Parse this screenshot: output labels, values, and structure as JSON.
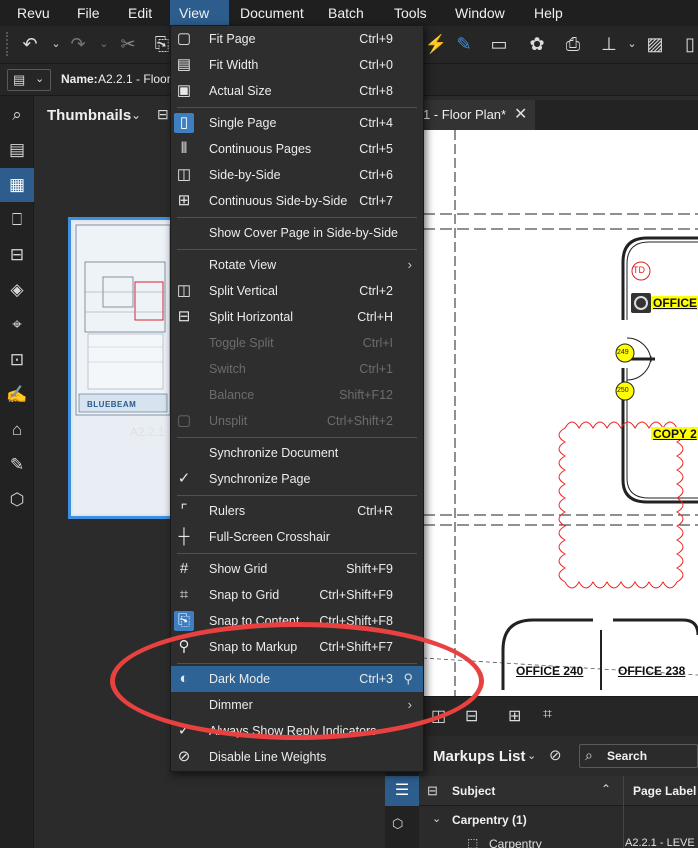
{
  "menubar": {
    "items": [
      "Revu",
      "File",
      "Edit",
      "View",
      "Document",
      "Batch",
      "Tools",
      "Window",
      "Help"
    ]
  },
  "namerow": {
    "name_label": "Name:",
    "name_value": "A2.2.1 - Floor"
  },
  "thumbnails": {
    "title": "Thumbnails",
    "caption": "A2.2.1 -",
    "brand": "BLUEBEAM"
  },
  "document_tab": {
    "label": "1 - Floor Plan*",
    "close": "✕"
  },
  "drawing": {
    "labels": [
      "OFFICE",
      "COPY 2",
      "OFFICE 240",
      "OFFICE 238",
      "TD",
      "249",
      "250"
    ]
  },
  "markups": {
    "title": "Markups List",
    "search_label": "Search",
    "col_subject": "Subject",
    "col_page_label": "Page Label",
    "group": "Carpentry (1)",
    "item": "Carpentry",
    "item_page": "A2.2.1 - LEVE"
  },
  "view_menu": {
    "items": [
      {
        "label": "Fit Page",
        "shortcut": "Ctrl+9",
        "icon": "fit-page-icon"
      },
      {
        "label": "Fit Width",
        "shortcut": "Ctrl+0",
        "icon": "fit-width-icon"
      },
      {
        "label": "Actual Size",
        "shortcut": "Ctrl+8",
        "icon": "actual-size-icon"
      },
      {
        "label": "Single Page",
        "shortcut": "Ctrl+4",
        "icon": "single-page-icon"
      },
      {
        "label": "Continuous Pages",
        "shortcut": "Ctrl+5",
        "icon": "continuous-pages-icon"
      },
      {
        "label": "Side-by-Side",
        "shortcut": "Ctrl+6",
        "icon": "side-by-side-icon"
      },
      {
        "label": "Continuous Side-by-Side",
        "shortcut": "Ctrl+7",
        "icon": "continuous-side-by-side-icon"
      },
      {
        "label": "Show Cover Page in Side-by-Side",
        "shortcut": "",
        "icon": ""
      },
      {
        "label": "Rotate View",
        "shortcut": "",
        "icon": ""
      },
      {
        "label": "Split Vertical",
        "shortcut": "Ctrl+2",
        "icon": "split-vertical-icon"
      },
      {
        "label": "Split Horizontal",
        "shortcut": "Ctrl+H",
        "icon": "split-horizontal-icon"
      },
      {
        "label": "Toggle Split",
        "shortcut": "Ctrl+I",
        "icon": ""
      },
      {
        "label": "Switch",
        "shortcut": "Ctrl+1",
        "icon": ""
      },
      {
        "label": "Balance",
        "shortcut": "Shift+F12",
        "icon": ""
      },
      {
        "label": "Unsplit",
        "shortcut": "Ctrl+Shift+2",
        "icon": "unsplit-icon"
      },
      {
        "label": "Synchronize Document",
        "shortcut": "",
        "icon": ""
      },
      {
        "label": "Synchronize Page",
        "shortcut": "",
        "icon": "checkmark-icon"
      },
      {
        "label": "Rulers",
        "shortcut": "Ctrl+R",
        "icon": "rulers-icon"
      },
      {
        "label": "Full-Screen Crosshair",
        "shortcut": "",
        "icon": "crosshair-icon"
      },
      {
        "label": "Show Grid",
        "shortcut": "Shift+F9",
        "icon": "grid-icon"
      },
      {
        "label": "Snap to Grid",
        "shortcut": "Ctrl+Shift+F9",
        "icon": "snap-grid-icon"
      },
      {
        "label": "Snap to Content",
        "shortcut": "Ctrl+Shift+F8",
        "icon": "snap-content-icon"
      },
      {
        "label": "Snap to Markup",
        "shortcut": "Ctrl+Shift+F7",
        "icon": "snap-markup-icon"
      },
      {
        "label": "Dark Mode",
        "shortcut": "Ctrl+3",
        "icon": "dark-mode-icon"
      },
      {
        "label": "Dimmer",
        "shortcut": "",
        "icon": ""
      },
      {
        "label": "Always Show Reply Indicators",
        "shortcut": "",
        "icon": "checkmark-icon"
      },
      {
        "label": "Disable Line Weights",
        "shortcut": "",
        "icon": "line-weights-icon"
      }
    ]
  },
  "colors": {
    "accent": "#2d5d8d",
    "annotation": "#e8413f",
    "highlight": "#ffff00"
  }
}
